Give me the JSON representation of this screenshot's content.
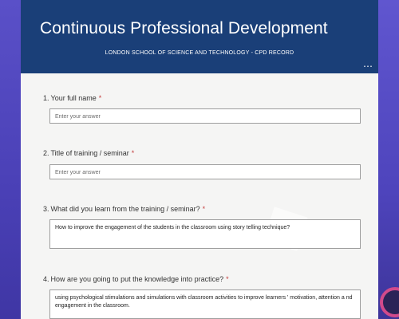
{
  "header": {
    "title": "Continuous Professional Development",
    "subtitle": "LONDON SCHOOL OF SCIENCE AND TECHNOLOGY - CPD RECORD",
    "more_icon": "more-horizontal-icon"
  },
  "questions": [
    {
      "number": "1.",
      "label": "Your full name",
      "required_mark": "*",
      "placeholder": "Enter your answer",
      "value": ""
    },
    {
      "number": "2.",
      "label": "Title of training / seminar",
      "required_mark": "*",
      "placeholder": "Enter your answer",
      "value": ""
    },
    {
      "number": "3.",
      "label": "What did you learn from the training / seminar?",
      "required_mark": "*",
      "placeholder": "",
      "value": "How to improve the engagement of the students in the classroom using story telling technique?"
    },
    {
      "number": "4.",
      "label": "How are you going to put the knowledge into practice?",
      "required_mark": "*",
      "placeholder": "",
      "value": "using psychological stimulations and simulations with classroom  activities  to improve learners ' motivation, attention a nd  engagement in the classroom."
    }
  ],
  "colors": {
    "header_bg": "#1a3f78",
    "page_bg": "#4a3fae",
    "required": "#c43e3e"
  }
}
